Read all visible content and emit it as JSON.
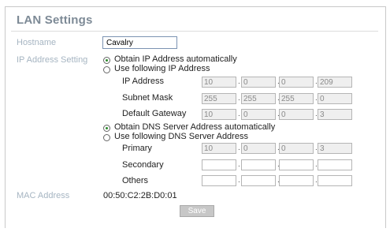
{
  "title": "LAN Settings",
  "hostname": {
    "label": "Hostname",
    "value": "Cavalry"
  },
  "ip_setting": {
    "label": "IP Address Setting",
    "options": [
      "Obtain IP Address automatically",
      "Use following IP Address"
    ],
    "selected_index": 0
  },
  "ip_fields": {
    "ip_address": {
      "label": "IP Address",
      "octets": [
        "10",
        "0",
        "0",
        "209"
      ]
    },
    "subnet_mask": {
      "label": "Subnet Mask",
      "octets": [
        "255",
        "255",
        "255",
        "0"
      ]
    },
    "default_gateway": {
      "label": "Default Gateway",
      "octets": [
        "10",
        "0",
        "0",
        "3"
      ]
    }
  },
  "dns_setting": {
    "options": [
      "Obtain DNS Server Address automatically",
      "Use following DNS Server Address"
    ],
    "selected_index": 0
  },
  "dns_fields": {
    "primary": {
      "label": "Primary",
      "octets": [
        "10",
        "0",
        "0",
        "3"
      ]
    },
    "secondary": {
      "label": "Secondary",
      "octets": [
        "",
        "",
        "",
        ""
      ]
    },
    "others": {
      "label": "Others",
      "octets": [
        "",
        "",
        "",
        ""
      ]
    }
  },
  "mac": {
    "label": "MAC Address",
    "value": "00:50:C2:2B:D0:01"
  },
  "save_label": "Save",
  "octet_separator": "."
}
